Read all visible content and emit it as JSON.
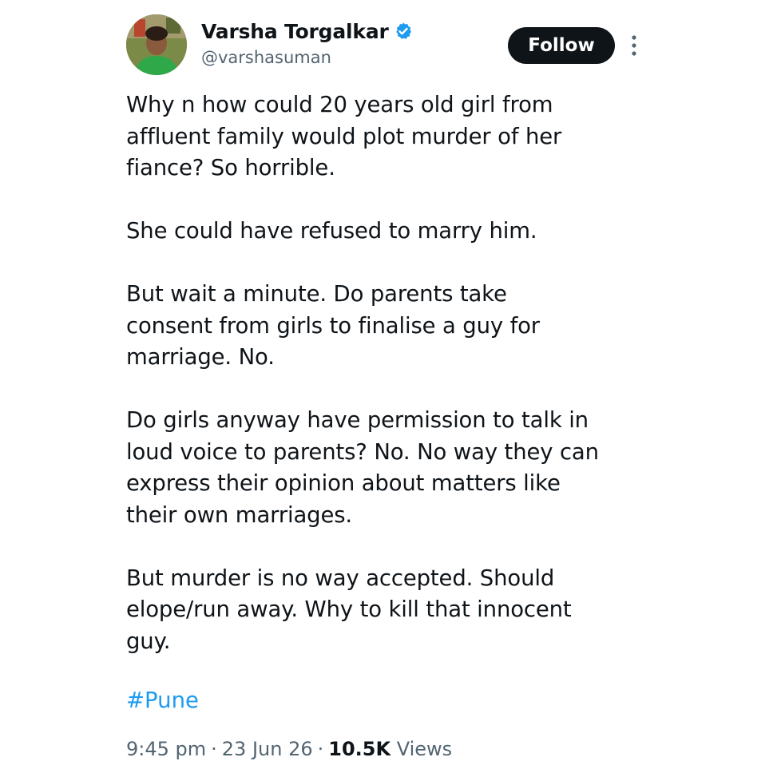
{
  "author": {
    "display_name": "Varsha Torgalkar",
    "handle": "@varshasuman",
    "verified_icon": "verified-badge-icon",
    "verified_color": "#1d9bf0"
  },
  "actions": {
    "follow_label": "Follow",
    "more_icon": "more-vertical-icon"
  },
  "tweet": {
    "paragraphs": [
      "Why n how could 20 years old girl from\naffluent family would plot murder of her\nfiance? So horrible.",
      "She could have refused to marry him.",
      "But wait a minute. Do parents take\nconsent from girls to finalise a guy for\nmarriage. No.",
      "Do girls anyway have permission to talk in\nloud voice to parents? No. No way they can\nexpress their opinion about matters like\ntheir own marriages.",
      "But murder is no way accepted. Should\nelope/run away.  Why to kill that innocent\nguy."
    ],
    "hashtag": "#Pune",
    "time": "9:45 pm",
    "date": "23 Jun 26",
    "views_count": "10.5K",
    "views_label": "Views",
    "separator": "·"
  },
  "colors": {
    "text_primary": "#0f1419",
    "text_secondary": "#536471",
    "link": "#1d9bf0",
    "button_bg": "#0f1419"
  }
}
